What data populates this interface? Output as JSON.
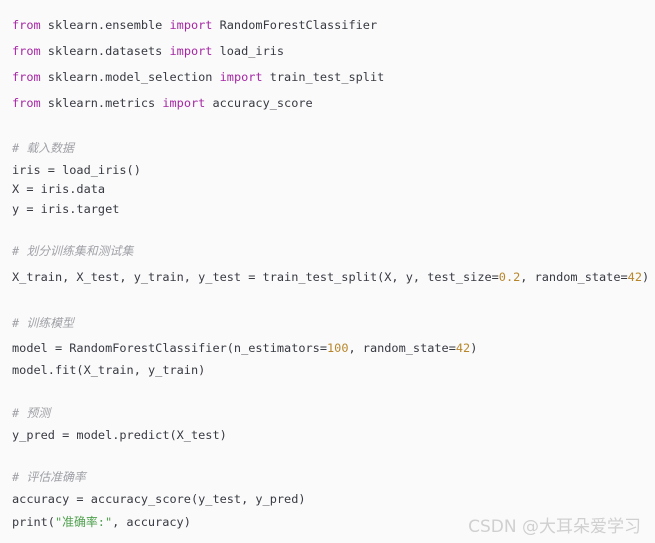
{
  "colors": {
    "background": "#fafafa",
    "text": "#383a42",
    "keyword": "#a626a4",
    "number": "#b8862a",
    "string": "#50a14f",
    "comment": "#a0a1a7"
  },
  "code_lines": [
    [
      [
        "kw",
        "from"
      ],
      [
        "t",
        " sklearn.ensemble "
      ],
      [
        "kw",
        "import"
      ],
      [
        "t",
        " RandomForestClassifier"
      ]
    ],
    [
      [
        "kw",
        "from"
      ],
      [
        "t",
        " sklearn.datasets "
      ],
      [
        "kw",
        "import"
      ],
      [
        "t",
        " load_iris"
      ]
    ],
    [
      [
        "kw",
        "from"
      ],
      [
        "t",
        " sklearn.model_selection "
      ],
      [
        "kw",
        "import"
      ],
      [
        "t",
        " train_test_split"
      ]
    ],
    [
      [
        "kw",
        "from"
      ],
      [
        "t",
        " sklearn.metrics "
      ],
      [
        "kw",
        "import"
      ],
      [
        "t",
        " accuracy_score"
      ]
    ],
    [
      [
        "com",
        "# 载入数据"
      ]
    ],
    [
      [
        "t",
        "iris = load_iris()"
      ]
    ],
    [
      [
        "t",
        "X = iris.data"
      ]
    ],
    [
      [
        "t",
        "y = iris.target"
      ]
    ],
    [
      [
        "com",
        "# 划分训练集和测试集"
      ]
    ],
    [
      [
        "t",
        "X_train, X_test, y_train, y_test = train_test_split(X, y, test_size="
      ],
      [
        "num",
        "0.2"
      ],
      [
        "t",
        ", random_state="
      ],
      [
        "num",
        "42"
      ],
      [
        "t",
        ")"
      ]
    ],
    [
      [
        "com",
        "# 训练模型"
      ]
    ],
    [
      [
        "t",
        "model = RandomForestClassifier(n_estimators="
      ],
      [
        "num",
        "100"
      ],
      [
        "t",
        ", random_state="
      ],
      [
        "num",
        "42"
      ],
      [
        "t",
        ")"
      ]
    ],
    [
      [
        "t",
        "model.fit(X_train, y_train)"
      ]
    ],
    [
      [
        "com",
        "# 预测"
      ]
    ],
    [
      [
        "t",
        "y_pred = model.predict(X_test)"
      ]
    ],
    [
      [
        "com",
        "# 评估准确率"
      ]
    ],
    [
      [
        "t",
        "accuracy = accuracy_score(y_test, y_pred)"
      ]
    ],
    [
      [
        "t",
        "print("
      ],
      [
        "str",
        "\"准确率:\""
      ],
      [
        "t",
        ", accuracy)"
      ]
    ]
  ],
  "watermark": "CSDN @大耳朵爱学习"
}
